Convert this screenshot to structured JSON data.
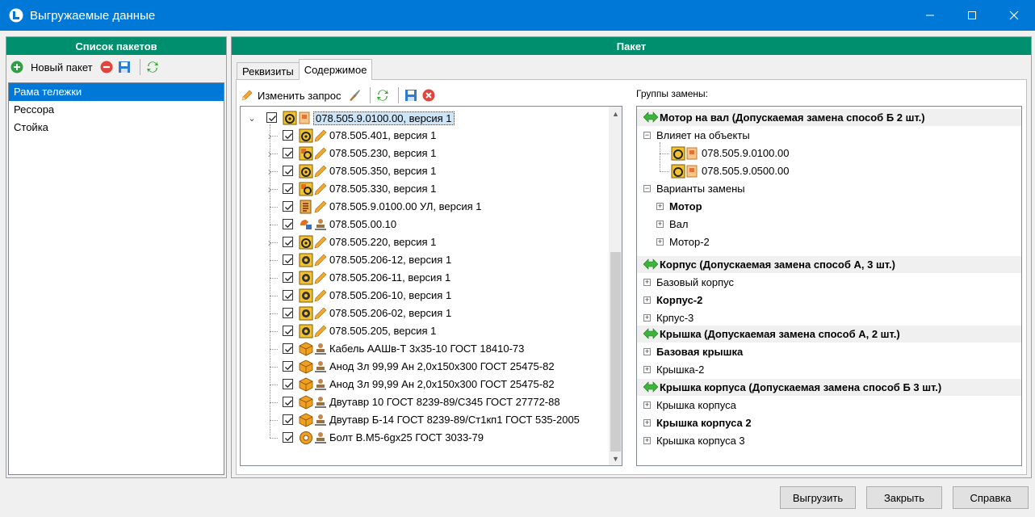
{
  "window": {
    "title": "Выгружаемые данные"
  },
  "left_panel": {
    "header": "Список пакетов",
    "new_package_label": "Новый пакет",
    "items": [
      {
        "label": "Рама тележки",
        "selected": true
      },
      {
        "label": "Рессора",
        "selected": false
      },
      {
        "label": "Стойка",
        "selected": false
      }
    ]
  },
  "right_panel": {
    "header": "Пакет",
    "tabs": [
      {
        "label": "Реквизиты"
      },
      {
        "label": "Содержимое"
      }
    ],
    "toolbar": {
      "edit_query_label": "Изменить запрос"
    },
    "tree": [
      {
        "label": "078.505.9.0100.00, версия 1"
      },
      {
        "label": "078.505.401, версия 1"
      },
      {
        "label": "078.505.230, версия 1"
      },
      {
        "label": "078.505.350, версия 1"
      },
      {
        "label": "078.505.330, версия 1"
      },
      {
        "label": "078.505.9.0100.00 УЛ, версия 1"
      },
      {
        "label": "078.505.00.10"
      },
      {
        "label": "078.505.220, версия 1"
      },
      {
        "label": "078.505.206-12, версия 1"
      },
      {
        "label": "078.505.206-11, версия 1"
      },
      {
        "label": "078.505.206-10, версия 1"
      },
      {
        "label": "078.505.206-02, версия 1"
      },
      {
        "label": "078.505.205, версия 1"
      },
      {
        "label": "Кабель ААШв-Т 3х35-10 ГОСТ 18410-73"
      },
      {
        "label": "Анод Зл 99,99 Ан 2,0х150х300 ГОСТ 25475-82"
      },
      {
        "label": "Анод Зл 99,99 Ан 2,0х150х300 ГОСТ 25475-82"
      },
      {
        "label": "Двутавр 10 ГОСТ 8239-89/С345 ГОСТ 27772-88"
      },
      {
        "label": "Двутавр Б-14 ГОСТ 8239-89/Ст1кп1 ГОСТ 535-2005"
      },
      {
        "label": "Болт В.М5-6gх25 ГОСТ 3033-79"
      }
    ],
    "groups_label": "Группы замены:",
    "groups": [
      {
        "title": "Мотор на вал (Допускаемая замена способ Б 2 шт.)"
      },
      {
        "label": "Влияет на объекты"
      },
      {
        "label": "078.505.9.0100.00"
      },
      {
        "label": "078.505.9.0500.00"
      },
      {
        "label": "Варианты замены"
      },
      {
        "label": "Мотор"
      },
      {
        "label": "Вал"
      },
      {
        "label": "Мотор-2"
      },
      {
        "title": "Корпус (Допускаемая замена способ А, 3 шт.)"
      },
      {
        "label": "Базовый корпус"
      },
      {
        "label": "Корпус-2"
      },
      {
        "label": "Крпус-3"
      },
      {
        "title": "Крышка (Допускаемая замена способ А, 2 шт.)"
      },
      {
        "label": "Базовая крышка"
      },
      {
        "label": "Крышка-2"
      },
      {
        "title": "Крышка корпуса (Допускаемая замена способ Б 3 шт.)"
      },
      {
        "label": "Крышка корпуса"
      },
      {
        "label": "Крышка корпуса 2"
      },
      {
        "label": "Крышка корпуса 3"
      }
    ]
  },
  "footer": {
    "export_label": "Выгрузить",
    "close_label": "Закрыть",
    "help_label": "Справка"
  },
  "colors": {
    "titlebar": "#0078d7",
    "panel_header": "#008f6e",
    "selection": "#0078d7",
    "arrow_green": "#3cb43c"
  }
}
